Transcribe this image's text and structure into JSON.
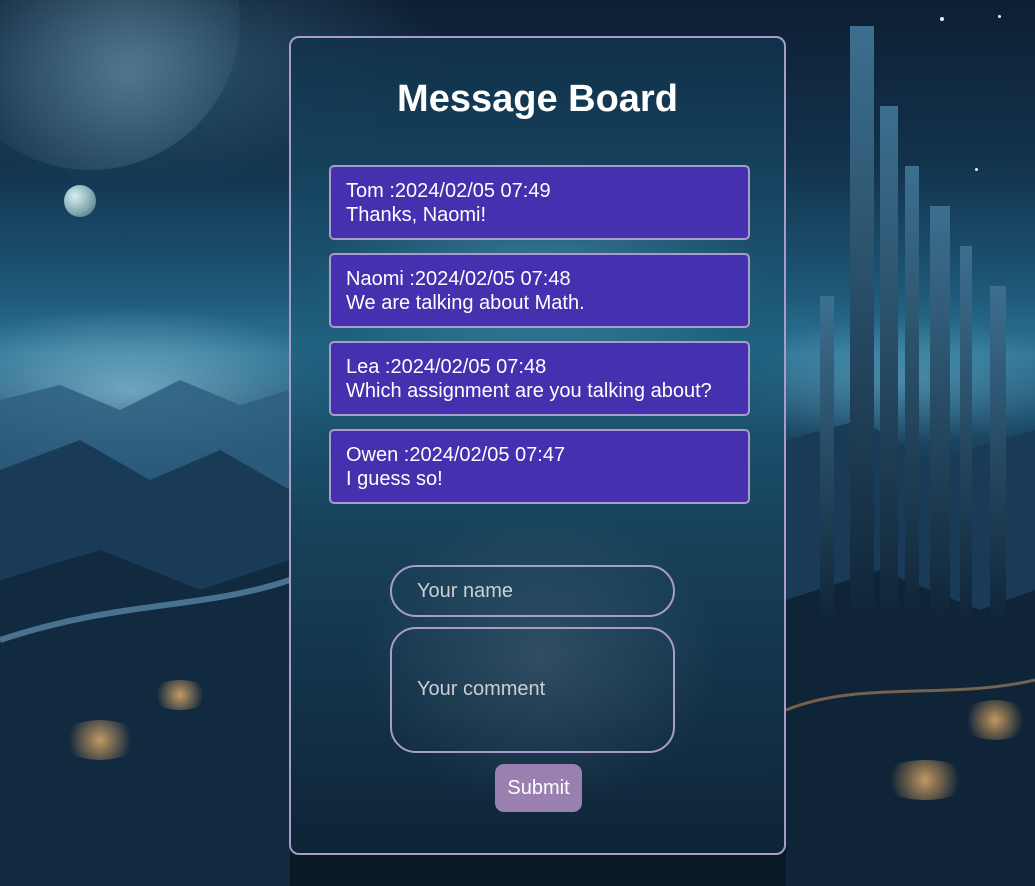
{
  "title": "Message Board",
  "messages": [
    {
      "meta": "Tom :2024/02/05 07:49",
      "text": "Thanks, Naomi!"
    },
    {
      "meta": "Naomi :2024/02/05 07:48",
      "text": "We are talking about Math."
    },
    {
      "meta": "Lea :2024/02/05 07:48",
      "text": "Which assignment are you talking about?"
    },
    {
      "meta": "Owen :2024/02/05 07:47",
      "text": "I guess so!"
    }
  ],
  "form": {
    "name_placeholder": "Your name",
    "name_value": "",
    "comment_placeholder": "Your comment",
    "comment_value": "",
    "submit_label": "Submit"
  },
  "colors": {
    "message_bg": "#4530b0",
    "border": "#a99cc8",
    "button_bg": "#9a80b0"
  }
}
